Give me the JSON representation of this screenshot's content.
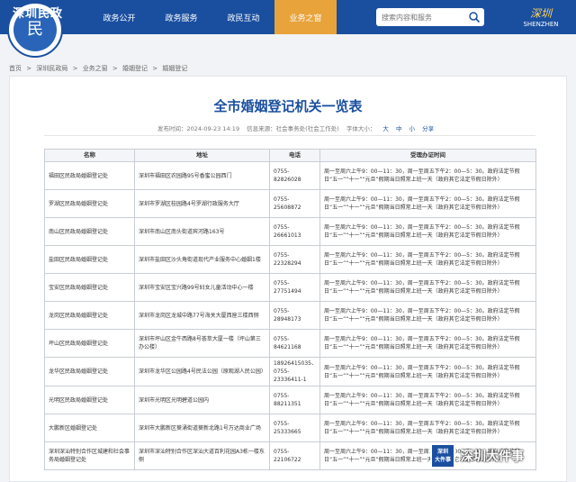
{
  "header": {
    "site_name": "深圳民政",
    "logo_glyph": "民",
    "nav": [
      {
        "label": "政务公开",
        "active": false
      },
      {
        "label": "政务服务",
        "active": false
      },
      {
        "label": "政民互动",
        "active": false
      },
      {
        "label": "业务之窗",
        "active": true
      }
    ],
    "search_placeholder": "搜索内容和服务",
    "brand_mark": "深圳",
    "brand_sub": "SHENZHEN"
  },
  "breadcrumb": [
    "首页",
    ">",
    "深圳民政局",
    ">",
    "业务之窗",
    ">",
    "婚姻登记",
    ">",
    "婚姻登记"
  ],
  "article": {
    "title": "全市婚姻登记机关一览表",
    "publish_time": "发布时间：2024-09-23 14:19",
    "source": "信息来源：社会事务处(社会工作处)",
    "font_size_label": "字体大小：",
    "font_big": "大",
    "font_mid": "中",
    "font_small": "小",
    "share": "分享"
  },
  "table": {
    "headers": [
      "名称",
      "地址",
      "电话",
      "受理办证时间"
    ],
    "rows": [
      {
        "name": "福田区民政局婚姻登记处",
        "address": "深圳市福田区农园路95号香蜜公园西门",
        "tel": "0755-82826028",
        "hours": "周一至周六上午9：00—11：30，周一至周五下午2：00—5：30。政府法定节假日“五一”“十一”“元旦”假期当日照常上班一天（政府其它法定节假日除外）"
      },
      {
        "name": "罗湖区民政局婚姻登记处",
        "address": "深圳市罗湖区桂园路4号罗湖行政服务大厅",
        "tel": "0755-25608872",
        "hours": "周一至周六上午9：00—11：30，周一至周五下午2：00—5：30。政府法定节假日“五一”“十一”“元旦”假期当日照常上班一天（政府其它法定节假日除外）"
      },
      {
        "name": "南山区民政局婚姻登记处",
        "address": "深圳市南山区南头街道宾河路163号",
        "tel": "0755-26661013",
        "hours": "周一至周六上午9：00—11：30，周一至周五下午2：00—5：30。政府法定节假日“五一”“十一”“元旦”假期当日照常上班一天（政府其它法定节假日除外）"
      },
      {
        "name": "盐田区民政局婚姻登记处",
        "address": "深圳市盐田区沙头角街道现代产业服务中心婚姻1楼",
        "tel": "0755-22328294",
        "hours": "周一至周六上午9：00—11：30，周一至周五下午2：00—5：30。政府法定节假日“五一”“十一”“元旦”假期当日照常上班一天（政府其它法定节假日除外）"
      },
      {
        "name": "宝安区民政局婚姻登记处",
        "address": "深圳市宝安区宝兴路99号妇女儿童活动中心一楼",
        "tel": "0755-27751494",
        "hours": "周一至周六上午9：00—11：30，周一至周五下午2：00—5：30。政府法定节假日“五一”“十一”“元旦”假期当日照常上班一天（政府其它法定节假日除外）"
      },
      {
        "name": "龙岗区民政局婚姻登记处",
        "address": "深圳市龙岗区龙城中路77号海关大厦西座三楼西侧",
        "tel": "0755-28948173",
        "hours": "周一至周六上午9：00—11：30，周一至周五下午2：00—5：30。政府法定节假日“五一”“十一”“元旦”假期当日照常上班一天（政府其它法定节假日除外）"
      },
      {
        "name": "坪山区民政局婚姻登记处",
        "address": "深圳市坪山区金牛西路8号荟萃大厦一楼（坪山第三办公楼）",
        "tel": "0755-84621168",
        "hours": "周一至周六上午9：00—11：30，周一至周五下午2：00—5：30。政府法定节假日“五一”“十一”“元旦”假期当日照常上班一天（政府其它法定节假日除外）"
      },
      {
        "name": "龙华区民政局婚姻登记处",
        "address": "深圳市龙华区公园路4号民法公园（原观湖人民公园）",
        "tel": "18926415035、0755-23336411-1",
        "hours": "周一至周六上午9：00—11：30，周一至周五下午2：00—5：30。政府法定节假日“五一”“十一”“元旦”假期当日照常上班一天（政府其它法定节假日除外）"
      },
      {
        "name": "光明区民政局婚姻登记处",
        "address": "深圳市光明区光明碧道公园内",
        "tel": "0755-88211351",
        "hours": "周一至周六上午9：00—11：30，周一至周五下午2：00—5：30。政府法定节假日“五一”“十一”“元旦”假期当日照常上班一天（政府其它法定节假日除外）"
      },
      {
        "name": "大鹏新区婚姻登记处",
        "address": "深圳市大鹏新区葵涌街道葵新北路1号万达商业广场",
        "tel": "0755-25333665",
        "hours": "周一至周六上午9：00—11：30，周一至周五下午2：00—5：30。政府法定节假日“五一”“十一”“元旦”假期当日照常上班一天（政府其它法定节假日除外）"
      },
      {
        "name": "深圳深汕特别合作区城建和社会事务局婚姻登记处",
        "address": "深圳市深汕特别合作区深汕大道百利花园A3栋一楼东侧",
        "tel": "0755-22106722",
        "hours": "周一至周六上午9：00—11：30，周一至周五下午2：00—5：30。政府法定节假日“五一”“十一”“元旦”假期当日照常上班一天（政府其它法定节假日除外）"
      }
    ]
  },
  "watermark": {
    "box_line1": "深圳",
    "box_line2": "大件事",
    "text": "深圳大件事"
  },
  "colors": {
    "header_blue": "#1a4fa0",
    "active_tab": "#e8a33a",
    "title_blue": "#1a4fa0"
  }
}
